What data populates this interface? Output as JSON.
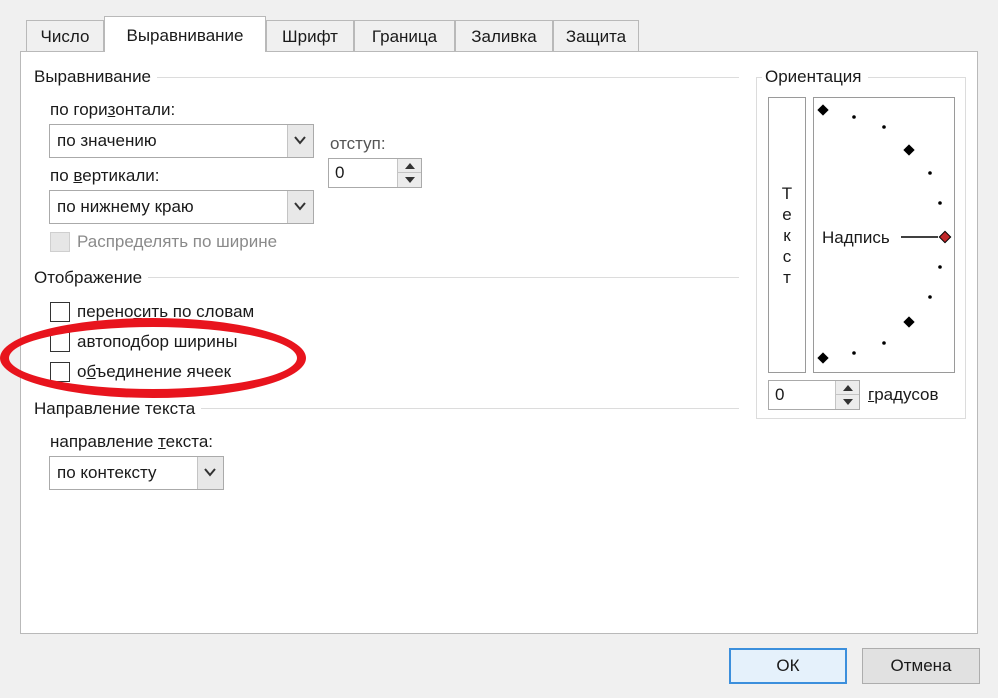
{
  "tabs": [
    "Число",
    "Выравнивание",
    "Шрифт",
    "Граница",
    "Заливка",
    "Защита"
  ],
  "active_tab": "Выравнивание",
  "alignment": {
    "section_title": "Выравнивание",
    "horizontal_label": "по горизонтали:",
    "horizontal_value": "по значению",
    "indent_label": "отступ:",
    "indent_value": "0",
    "vertical_label": "по вертикали:",
    "vertical_value": "по нижнему краю",
    "distribute_label": "Распределять по ширине"
  },
  "display": {
    "section_title": "Отображение",
    "wrap_label": "переносить по словам",
    "shrink_label": "автоподбор ширины",
    "merge_label": "объединение ячеек"
  },
  "text_direction": {
    "section_title": "Направление текста",
    "direction_label": "направление текста:",
    "direction_value": "по контексту"
  },
  "orientation": {
    "section_title": "Ориентация",
    "vertical_text": [
      "Т",
      "е",
      "к",
      "с",
      "т"
    ],
    "dial_label": "Надпись",
    "degrees_value": "0",
    "degrees_label": "градусов"
  },
  "buttons": {
    "ok": "ОК",
    "cancel": "Отмена"
  },
  "colors": {
    "highlight": "#e8141d",
    "dial_marker": "#c0282a"
  }
}
